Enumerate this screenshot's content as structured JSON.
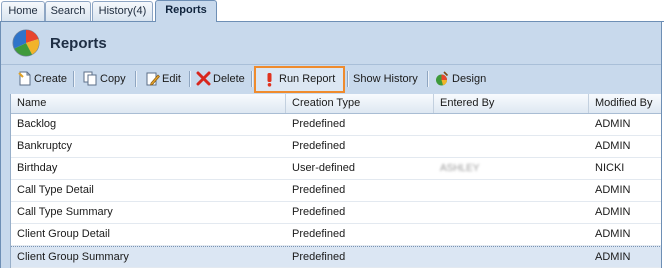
{
  "tabs": [
    {
      "label": "Home",
      "active": false
    },
    {
      "label": "Search",
      "active": false
    },
    {
      "label": "History(4)",
      "active": false
    },
    {
      "label": "Reports",
      "active": true
    }
  ],
  "header": {
    "title": "Reports",
    "icon": "pie-chart-icon"
  },
  "toolbar": {
    "create": "Create",
    "copy": "Copy",
    "edit": "Edit",
    "delete": "Delete",
    "run_report": "Run Report",
    "show_history": "Show History",
    "design": "Design",
    "highlight_color": "#ef8b2d"
  },
  "grid": {
    "columns": [
      "Name",
      "Creation Type",
      "Entered By",
      "Modified By"
    ],
    "rows": [
      {
        "name": "Backlog",
        "type": "Predefined",
        "entered_by": "",
        "modified_by": "ADMIN"
      },
      {
        "name": "Bankruptcy",
        "type": "Predefined",
        "entered_by": "",
        "modified_by": "ADMIN"
      },
      {
        "name": "Birthday",
        "type": "User-defined",
        "entered_by": "ASHLEY",
        "modified_by": "NICKI"
      },
      {
        "name": "Call Type Detail",
        "type": "Predefined",
        "entered_by": "",
        "modified_by": "ADMIN"
      },
      {
        "name": "Call Type Summary",
        "type": "Predefined",
        "entered_by": "",
        "modified_by": "ADMIN"
      },
      {
        "name": "Client Group Detail",
        "type": "Predefined",
        "entered_by": "",
        "modified_by": "ADMIN"
      },
      {
        "name": "Client Group Summary",
        "type": "Predefined",
        "entered_by": "",
        "modified_by": "ADMIN"
      }
    ],
    "selected_row": 6
  }
}
